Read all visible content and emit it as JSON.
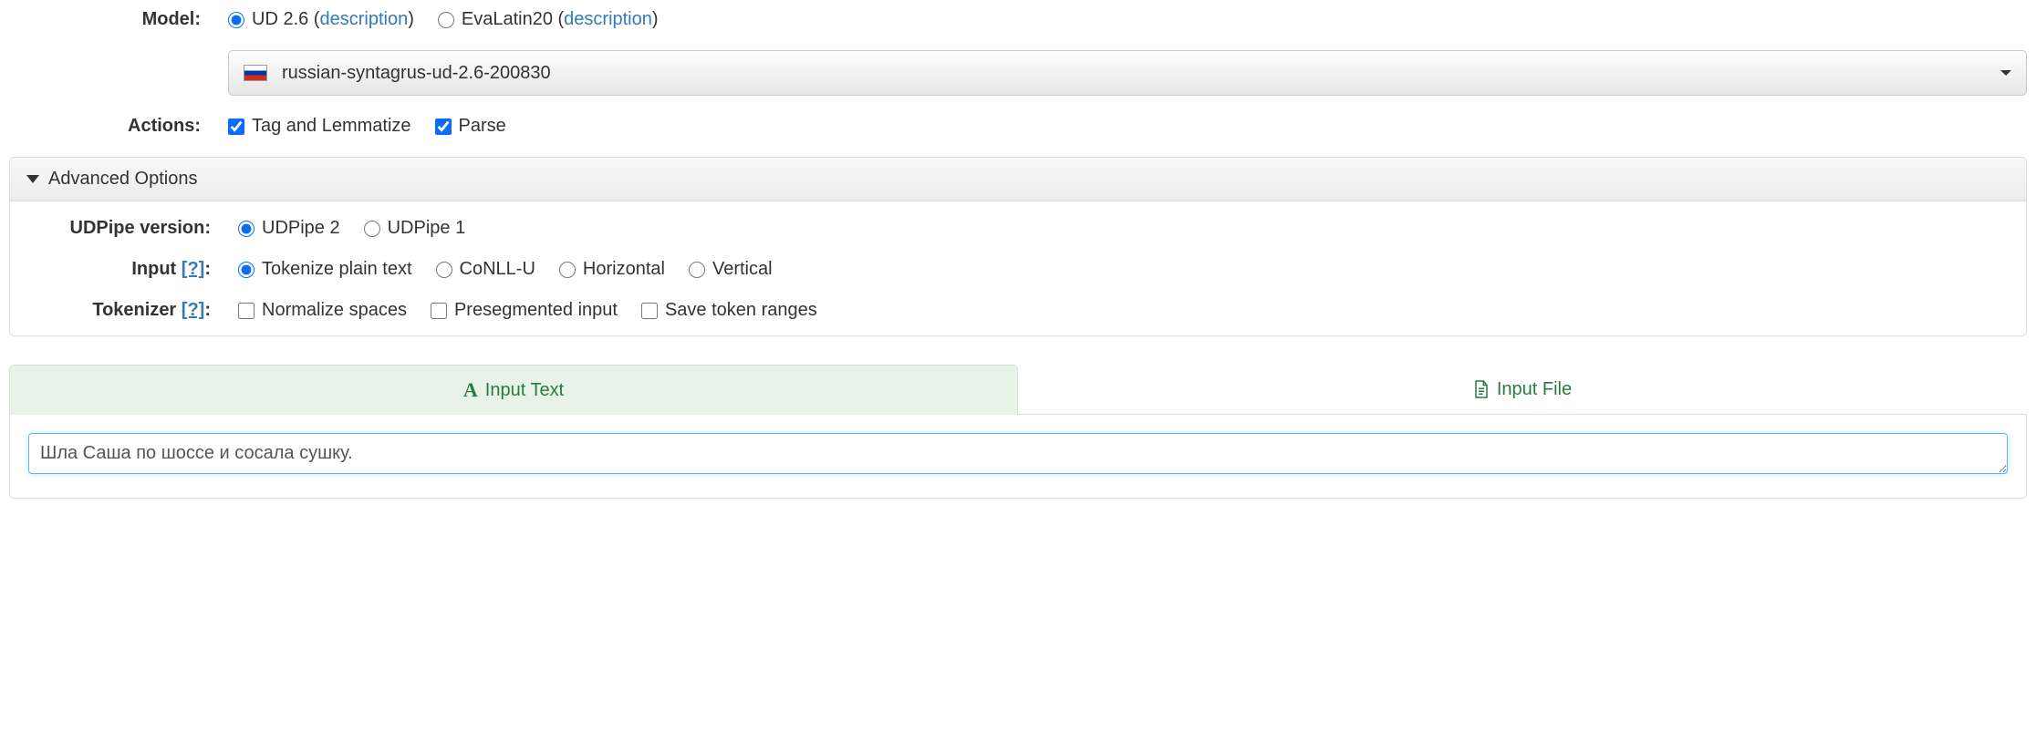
{
  "model": {
    "label": "Model:",
    "options": [
      {
        "label": "UD 2.6",
        "desc_text": "description",
        "checked": true
      },
      {
        "label": "EvaLatin20",
        "desc_text": "description",
        "checked": false
      }
    ],
    "selected": "russian-syntagrus-ud-2.6-200830"
  },
  "actions": {
    "label": "Actions:",
    "items": [
      {
        "label": "Tag and Lemmatize",
        "checked": true
      },
      {
        "label": "Parse",
        "checked": true
      }
    ]
  },
  "advanced": {
    "heading": "Advanced Options",
    "version": {
      "label": "UDPipe version:",
      "options": [
        {
          "label": "UDPipe 2",
          "checked": true
        },
        {
          "label": "UDPipe 1",
          "checked": false
        }
      ]
    },
    "input": {
      "label": "Input",
      "help": "[?]",
      "options": [
        {
          "label": "Tokenize plain text",
          "checked": true
        },
        {
          "label": "CoNLL-U",
          "checked": false
        },
        {
          "label": "Horizontal",
          "checked": false
        },
        {
          "label": "Vertical",
          "checked": false
        }
      ]
    },
    "tokenizer": {
      "label": "Tokenizer",
      "help": "[?]",
      "options": [
        {
          "label": "Normalize spaces",
          "checked": false
        },
        {
          "label": "Presegmented input",
          "checked": false
        },
        {
          "label": "Save token ranges",
          "checked": false
        }
      ]
    }
  },
  "tabs": {
    "text": "Input Text",
    "file": "Input File"
  },
  "input_text": "Шла Саша по шоссе и сосала сушку."
}
